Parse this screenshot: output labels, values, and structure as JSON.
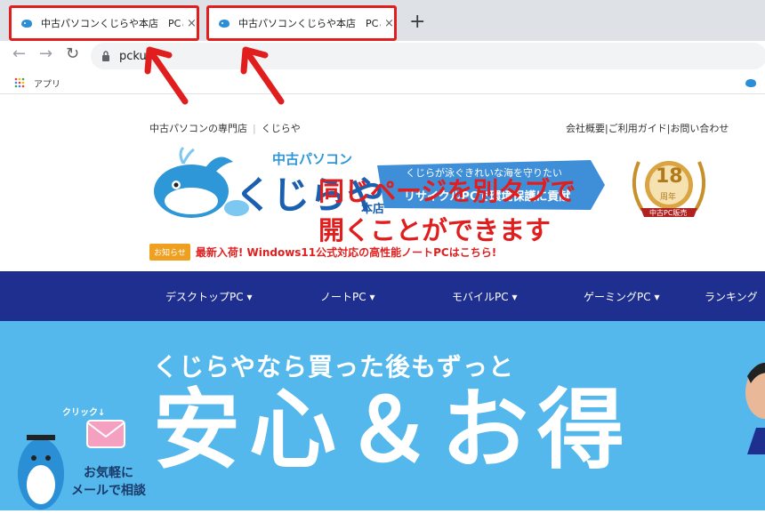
{
  "browser": {
    "tabs": [
      {
        "title": "中古パソコンくじらや本店　PCと安心",
        "close": "×"
      },
      {
        "title": "中古パソコンくじらや本店　PCと安心",
        "close": "×"
      }
    ],
    "new_tab": "+",
    "address": "pckuji",
    "bookmarks": {
      "apps_label": "アプリ"
    }
  },
  "annotation": {
    "line1": "同じページを別タブで",
    "line2": "開くことができます",
    "color": "#e01e1e"
  },
  "site": {
    "topnav_left": [
      "中古パソコンの専門店",
      "くじらや"
    ],
    "topnav_right": [
      "会社概要",
      "ご利用ガイド",
      "お問い合わせ"
    ],
    "logo": {
      "small": "中古パソコン",
      "main": "くじらや",
      "suffix": "本店"
    },
    "banner": {
      "line1": "くじらが泳ぐきれいな海を守りたい",
      "line2": "リサイクルPCで環境保護に貢献"
    },
    "badge": {
      "number": "18",
      "unit": "周年",
      "ribbon": "中古PC販売"
    },
    "news": {
      "tag": "お知らせ",
      "text": "最新入荷! Windows11公式対応の高性能ノートPCはこちら!"
    },
    "mainnav": [
      "デスクトップPC",
      "ノートPC",
      "モバイルPC",
      "ゲーミングPC",
      "ランキング"
    ],
    "hero": {
      "sub": "くじらやなら買った後もずっと",
      "big": "安心＆お得"
    },
    "mascot": {
      "click": "クリック↓",
      "line1": "お気軽に",
      "line2": "メールで相談"
    },
    "colors": {
      "nav": "#1f2f8f",
      "hero": "#55b8ec",
      "news": "#e02020"
    }
  }
}
